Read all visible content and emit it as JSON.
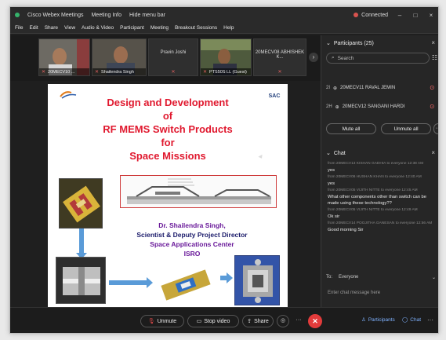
{
  "window": {
    "tabs": [
      "Cisco Webex Meetings",
      "Meeting Info",
      "Hide menu bar"
    ],
    "connection_label": "Connected",
    "controls": [
      "–",
      "□",
      "×"
    ]
  },
  "menu": [
    "File",
    "Edit",
    "Share",
    "View",
    "Audio & Video",
    "Participant",
    "Meeting",
    "Breakout Sessions",
    "Help"
  ],
  "video_strip": {
    "tiles": [
      {
        "name": "20MECV10 ...",
        "has_video": true
      },
      {
        "name": "Shailendra Singh",
        "has_video": true
      },
      {
        "name": "Pravin Joshi",
        "has_video": false
      },
      {
        "name": "PTS50S LL (Guest)",
        "has_video": true
      },
      {
        "name": "20MECV08 ABHISHEK K...",
        "has_video": false
      }
    ],
    "next_label": "›"
  },
  "slide": {
    "title_lines": [
      "Design and Development",
      "of",
      "RF MEMS Switch Products",
      "for",
      "Space Missions"
    ],
    "author_lines": [
      "Dr. Shailendra Singh,",
      "Scientist & Deputy Project Director",
      "Space Applications Center",
      "ISRO"
    ],
    "logo_right": "SAC"
  },
  "participants": {
    "header": "Participants (25)",
    "search_placeholder": "Search",
    "rows": [
      {
        "badge": "2I",
        "name": "20MECV11 RAVAL JEMIN"
      },
      {
        "badge": "2H",
        "name": "20MECV12 SANGANI HARDI"
      }
    ],
    "mute_all": "Mute all",
    "unmute_all": "Unmute all",
    "more": "···"
  },
  "chat": {
    "header": "Chat",
    "messages": [
      {
        "meta": "from 20MECV13 KISHAN GADHIA to everyone  12:38 AM",
        "text": "yes"
      },
      {
        "meta": "from 20MECV06 HUSHAN KHAN to everyone  12:40 AM",
        "text": "yes"
      },
      {
        "meta": "from 20MECV05 VIJITH NITTE to everyone  12:45 AM",
        "text": "What other components other than switch can be made using these technology??"
      },
      {
        "meta": "from 20MECV05 VIJITH NITTE to everyone  12:49 AM",
        "text": "Ok sir"
      },
      {
        "meta": "from 20MECV14 POOJITHA GANESAN to everyone  12:56 AM",
        "text": "Good morning Sir"
      }
    ],
    "to_label": "To:",
    "to_value": "Everyone",
    "input_placeholder": "Enter chat message here"
  },
  "toolbar": {
    "unmute": "Unmute",
    "stop_video": "Stop video",
    "share": "Share",
    "participants": "Participants",
    "chat": "Chat"
  },
  "colors": {
    "slide_title": "#e0182e",
    "mute_red": "#e06060",
    "end_call": "#e23b3b",
    "link_blue": "#7fb2ff"
  }
}
